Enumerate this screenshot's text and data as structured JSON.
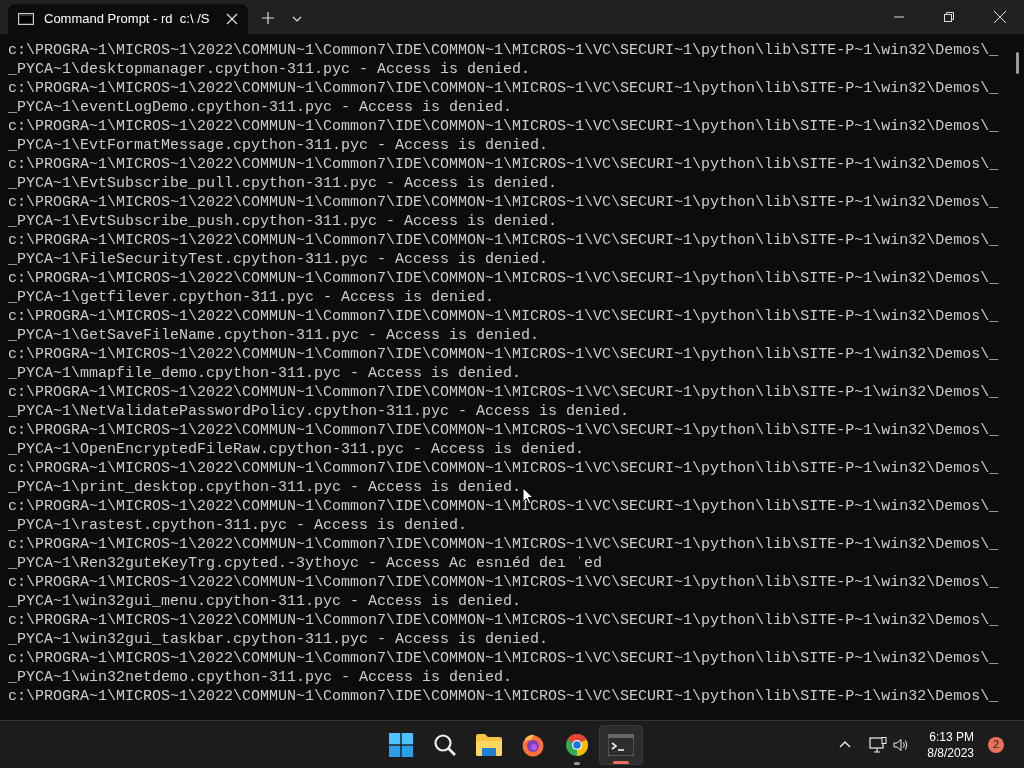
{
  "window": {
    "tab_title": "Command Prompt - rd  c:\\ /S"
  },
  "terminal": {
    "lines": [
      "c:\\PROGRA~1\\MICROS~1\\2022\\COMMUN~1\\Common7\\IDE\\COMMON~1\\MICROS~1\\VC\\SECURI~1\\python\\lib\\SITE-P~1\\win32\\Demos\\_",
      "_PYCA~1\\desktopmanager.cpython-311.pyc - Access is denied.",
      "c:\\PROGRA~1\\MICROS~1\\2022\\COMMUN~1\\Common7\\IDE\\COMMON~1\\MICROS~1\\VC\\SECURI~1\\python\\lib\\SITE-P~1\\win32\\Demos\\_",
      "_PYCA~1\\eventLogDemo.cpython-311.pyc - Access is denied.",
      "c:\\PROGRA~1\\MICROS~1\\2022\\COMMUN~1\\Common7\\IDE\\COMMON~1\\MICROS~1\\VC\\SECURI~1\\python\\lib\\SITE-P~1\\win32\\Demos\\_",
      "_PYCA~1\\EvtFormatMessage.cpython-311.pyc - Access is denied.",
      "c:\\PROGRA~1\\MICROS~1\\2022\\COMMUN~1\\Common7\\IDE\\COMMON~1\\MICROS~1\\VC\\SECURI~1\\python\\lib\\SITE-P~1\\win32\\Demos\\_",
      "_PYCA~1\\EvtSubscribe_pull.cpython-311.pyc - Access is denied.",
      "c:\\PROGRA~1\\MICROS~1\\2022\\COMMUN~1\\Common7\\IDE\\COMMON~1\\MICROS~1\\VC\\SECURI~1\\python\\lib\\SITE-P~1\\win32\\Demos\\_",
      "_PYCA~1\\EvtSubscribe_push.cpython-311.pyc - Access is denied.",
      "c:\\PROGRA~1\\MICROS~1\\2022\\COMMUN~1\\Common7\\IDE\\COMMON~1\\MICROS~1\\VC\\SECURI~1\\python\\lib\\SITE-P~1\\win32\\Demos\\_",
      "_PYCA~1\\FileSecurityTest.cpython-311.pyc - Access is denied.",
      "c:\\PROGRA~1\\MICROS~1\\2022\\COMMUN~1\\Common7\\IDE\\COMMON~1\\MICROS~1\\VC\\SECURI~1\\python\\lib\\SITE-P~1\\win32\\Demos\\_",
      "_PYCA~1\\getfilever.cpython-311.pyc - Access is denied.",
      "c:\\PROGRA~1\\MICROS~1\\2022\\COMMUN~1\\Common7\\IDE\\COMMON~1\\MICROS~1\\VC\\SECURI~1\\python\\lib\\SITE-P~1\\win32\\Demos\\_",
      "_PYCA~1\\GetSaveFileName.cpython-311.pyc - Access is denied.",
      "c:\\PROGRA~1\\MICROS~1\\2022\\COMMUN~1\\Common7\\IDE\\COMMON~1\\MICROS~1\\VC\\SECURI~1\\python\\lib\\SITE-P~1\\win32\\Demos\\_",
      "_PYCA~1\\mmapfile_demo.cpython-311.pyc - Access is denied.",
      "c:\\PROGRA~1\\MICROS~1\\2022\\COMMUN~1\\Common7\\IDE\\COMMON~1\\MICROS~1\\VC\\SECURI~1\\python\\lib\\SITE-P~1\\win32\\Demos\\_",
      "_PYCA~1\\NetValidatePasswordPolicy.cpython-311.pyc - Access is denied.",
      "c:\\PROGRA~1\\MICROS~1\\2022\\COMMUN~1\\Common7\\IDE\\COMMON~1\\MICROS~1\\VC\\SECURI~1\\python\\lib\\SITE-P~1\\win32\\Demos\\_",
      "_PYCA~1\\OpenEncryptedFileRaw.cpython-311.pyc - Access is denied.",
      "c:\\PROGRA~1\\MICROS~1\\2022\\COMMUN~1\\Common7\\IDE\\COMMON~1\\MICROS~1\\VC\\SECURI~1\\python\\lib\\SITE-P~1\\win32\\Demos\\_",
      "_PYCA~1\\print_desktop.cpython-311.pyc - Access is denied.",
      "c:\\PROGRA~1\\MICROS~1\\2022\\COMMUN~1\\Common7\\IDE\\COMMON~1\\MICROS~1\\VC\\SECURI~1\\python\\lib\\SITE-P~1\\win32\\Demos\\_",
      "_PYCA~1\\rastest.cpython-311.pyc - Access is denied.",
      "c:\\PROGRA~1\\MICROS~1\\2022\\COMMUN~1\\Common7\\IDE\\COMMON~1\\MICROS~1\\VC\\SECURI~1\\python\\lib\\SITE-P~1\\win32\\Demos\\_",
      "_PYCA~1\\Ren32guteKeyTrg.cpyted.-3ythoyc - Access Ac esnıéd deı ˈed",
      "c:\\PROGRA~1\\MICROS~1\\2022\\COMMUN~1\\Common7\\IDE\\COMMON~1\\MICROS~1\\VC\\SECURI~1\\python\\lib\\SITE-P~1\\win32\\Demos\\_",
      "_PYCA~1\\win32gui_menu.cpython-311.pyc - Access is denied.",
      "c:\\PROGRA~1\\MICROS~1\\2022\\COMMUN~1\\Common7\\IDE\\COMMON~1\\MICROS~1\\VC\\SECURI~1\\python\\lib\\SITE-P~1\\win32\\Demos\\_",
      "_PYCA~1\\win32gui_taskbar.cpython-311.pyc - Access is denied.",
      "c:\\PROGRA~1\\MICROS~1\\2022\\COMMUN~1\\Common7\\IDE\\COMMON~1\\MICROS~1\\VC\\SECURI~1\\python\\lib\\SITE-P~1\\win32\\Demos\\_",
      "_PYCA~1\\win32netdemo.cpython-311.pyc - Access is denied.",
      "c:\\PROGRA~1\\MICROS~1\\2022\\COMMUN~1\\Common7\\IDE\\COMMON~1\\MICROS~1\\VC\\SECURI~1\\python\\lib\\SITE-P~1\\win32\\Demos\\_"
    ]
  },
  "taskbar": {
    "apps": [
      {
        "kind": "start",
        "selected": false,
        "running": false
      },
      {
        "kind": "search",
        "selected": false,
        "running": false
      },
      {
        "kind": "explorer",
        "selected": false,
        "running": false
      },
      {
        "kind": "firefox",
        "selected": false,
        "running": false
      },
      {
        "kind": "chrome",
        "selected": false,
        "running": true
      },
      {
        "kind": "terminal",
        "selected": true,
        "running": true
      }
    ],
    "time": "6:13 PM",
    "date": "8/8/2023",
    "notification_count": "2"
  }
}
